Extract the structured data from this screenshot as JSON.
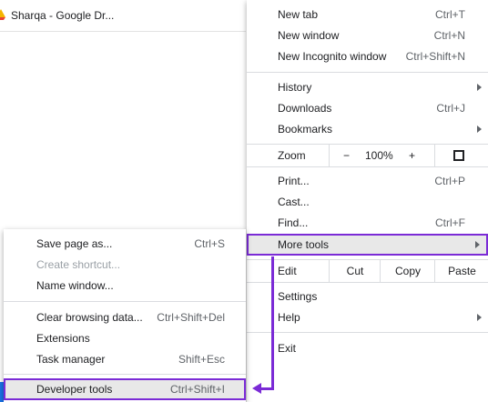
{
  "background": {
    "tab_title": "Sharqa - Google Dr..."
  },
  "main_menu": {
    "new_tab": {
      "label": "New tab",
      "shortcut": "Ctrl+T"
    },
    "new_window": {
      "label": "New window",
      "shortcut": "Ctrl+N"
    },
    "new_incognito": {
      "label": "New Incognito window",
      "shortcut": "Ctrl+Shift+N"
    },
    "history": {
      "label": "History"
    },
    "downloads": {
      "label": "Downloads",
      "shortcut": "Ctrl+J"
    },
    "bookmarks": {
      "label": "Bookmarks"
    },
    "zoom": {
      "label": "Zoom",
      "minus": "−",
      "value": "100%",
      "plus": "+"
    },
    "print": {
      "label": "Print...",
      "shortcut": "Ctrl+P"
    },
    "cast": {
      "label": "Cast..."
    },
    "find": {
      "label": "Find...",
      "shortcut": "Ctrl+F"
    },
    "more_tools": {
      "label": "More tools"
    },
    "edit": {
      "label": "Edit",
      "cut": "Cut",
      "copy": "Copy",
      "paste": "Paste"
    },
    "settings": {
      "label": "Settings"
    },
    "help": {
      "label": "Help"
    },
    "exit": {
      "label": "Exit"
    }
  },
  "sub_menu": {
    "save_page": {
      "label": "Save page as...",
      "shortcut": "Ctrl+S"
    },
    "create_shortcut": {
      "label": "Create shortcut..."
    },
    "name_window": {
      "label": "Name window..."
    },
    "clear_data": {
      "label": "Clear browsing data...",
      "shortcut": "Ctrl+Shift+Del"
    },
    "extensions": {
      "label": "Extensions"
    },
    "task_manager": {
      "label": "Task manager",
      "shortcut": "Shift+Esc"
    },
    "developer_tools": {
      "label": "Developer tools",
      "shortcut": "Ctrl+Shift+I"
    }
  },
  "colors": {
    "highlight_outline": "#7b2bd6",
    "hover_background": "#e8e8e8"
  },
  "icons": [
    "favicon-icon",
    "submenu-arrow-icon",
    "fullscreen-icon"
  ]
}
